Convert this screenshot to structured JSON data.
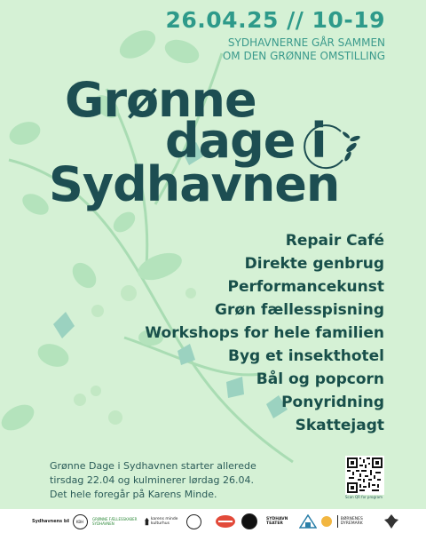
{
  "event": {
    "date": "26.04.25 // 10-19",
    "tagline_line1": "SYDHAVNERNE GÅR SAMMEN",
    "tagline_line2": "OM DEN GRØNNE OMSTILLING",
    "title_line1": "Grønne",
    "title_line2": "dage i",
    "title_line3": "Sydhavnen"
  },
  "activities": [
    "Repair Café",
    "Direkte genbrug",
    "Performancekunst",
    "Grøn fællesspisning",
    "Workshops for hele familien",
    "Byg et insekthotel",
    "Bål og popcorn",
    "Ponyridning",
    "Skattejagt"
  ],
  "info": {
    "line1": "Grønne Dage i Sydhavnen starter allerede",
    "line2": "tirsdag 22.04 og kulminerer lørdag 26.04.",
    "line3": "Det hele foregår på Karens Minde."
  },
  "qr": {
    "caption": "Scan QR for program"
  },
  "sponsors": {
    "sydhavnens_bibliotek": "Sydhavnens bibliotek",
    "kbh_kommune": "KBH",
    "groenne_foreninger": "GRØNNE FÆLLESSKABER SYDHAVNEN",
    "karens_minde": "karens minde kulturhus",
    "sydhavn_teater": "SYDHAVN TEATER",
    "boernenes_dyremark": "BØRNENES DYREMARK"
  },
  "colors": {
    "background": "#d5f1d5",
    "title": "#1d4e52",
    "accent": "#2e9a8a",
    "text": "#184f4a"
  }
}
